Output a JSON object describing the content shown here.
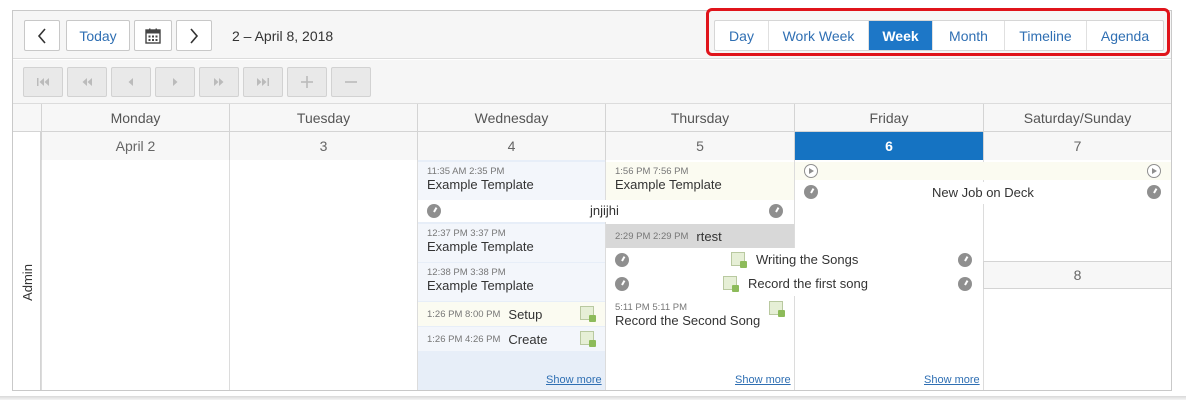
{
  "toolbar": {
    "today_label": "Today",
    "date_range": "2 – April 8, 2018"
  },
  "views": [
    {
      "label": "Day",
      "active": false
    },
    {
      "label": "Work Week",
      "active": false
    },
    {
      "label": "Week",
      "active": true
    },
    {
      "label": "Month",
      "active": false
    },
    {
      "label": "Timeline",
      "active": false
    },
    {
      "label": "Agenda",
      "active": false
    }
  ],
  "calendar": {
    "days": [
      "Monday",
      "Tuesday",
      "Wednesday",
      "Thursday",
      "Friday",
      "Saturday/Sunday"
    ],
    "dates": [
      "April 2",
      "3",
      "4",
      "5",
      "6",
      "7"
    ],
    "sunday_date": "8",
    "resource": "Admin",
    "show_more": "Show more"
  },
  "events": {
    "wed": [
      {
        "time": "11:35 AM 2:35 PM",
        "title": "Example Template"
      },
      {
        "time": "",
        "title": "jnjijhi"
      },
      {
        "time": "12:37 PM 3:37 PM",
        "title": "Example Template"
      },
      {
        "time": "12:38 PM 3:38 PM",
        "title": "Example Template"
      },
      {
        "time": "1:26 PM 8:00 PM",
        "title": "Setup"
      },
      {
        "time": "1:26 PM 4:26 PM",
        "title": "Create"
      }
    ],
    "thu": [
      {
        "time": "1:56 PM 7:56 PM",
        "title": "Example Template"
      },
      {
        "time": "2:29 PM 2:29 PM",
        "title": "rtest"
      },
      {
        "time": "",
        "title": "Writing the Songs"
      },
      {
        "time": "",
        "title": "Record the first song"
      },
      {
        "time": "5:11 PM 5:11 PM",
        "title": "Record the Second Song"
      }
    ],
    "fri": [
      {
        "time": "",
        "title": "New Job on Deck"
      }
    ]
  },
  "colors": {
    "accent": "#1d77c7",
    "today": "#1573c2",
    "highlight": "#e0141b",
    "link": "#2f6fb3"
  }
}
